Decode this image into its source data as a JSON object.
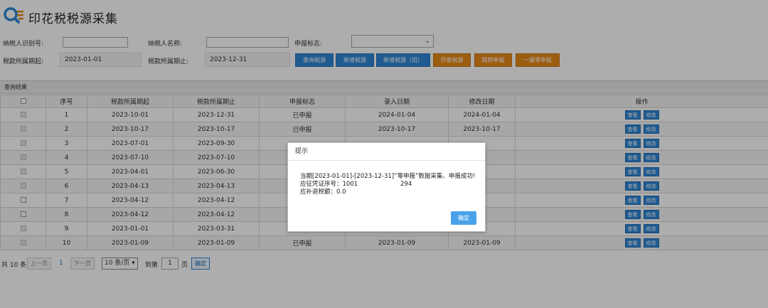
{
  "header": {
    "title": "印花税税源采集"
  },
  "form": {
    "taxpayer_id_label": "纳税人识别号:",
    "taxpayer_name_label": "纳税人名称:",
    "declare_flag_label": "申报标志:",
    "period_start_label": "税款所属期起:",
    "period_start_value": "2023-01-01",
    "period_end_label": "税款所属期止:",
    "period_end_value": "2023-12-31"
  },
  "toolbar": {
    "query": "查询税源",
    "add": "新增税源",
    "add_old": "新增税源（旧）",
    "void": "作废税源",
    "jump": "跳转申报",
    "zero": "一键零申报"
  },
  "results": {
    "title": "查询结果",
    "columns": [
      "序号",
      "税款所属期起",
      "税款所属期止",
      "申报标志",
      "录入日期",
      "修改日期",
      "操作"
    ],
    "view_label": "查看",
    "edit_label": "修改",
    "rows": [
      {
        "no": "1",
        "start": "2023-10-01",
        "end": "2023-12-31",
        "flag": "已申报",
        "entry": "2024-01-04",
        "modify": "2024-01-04"
      },
      {
        "no": "2",
        "start": "2023-10-17",
        "end": "2023-10-17",
        "flag": "已申报",
        "entry": "2023-10-17",
        "modify": "2023-10-17"
      },
      {
        "no": "3",
        "start": "2023-07-01",
        "end": "2023-09-30",
        "flag": "",
        "entry": "",
        "modify": ""
      },
      {
        "no": "4",
        "start": "2023-07-10",
        "end": "2023-07-10",
        "flag": "",
        "entry": "",
        "modify": ""
      },
      {
        "no": "5",
        "start": "2023-04-01",
        "end": "2023-06-30",
        "flag": "",
        "entry": "",
        "modify": ""
      },
      {
        "no": "6",
        "start": "2023-04-13",
        "end": "2023-04-13",
        "flag": "",
        "entry": "",
        "modify": ""
      },
      {
        "no": "7",
        "start": "2023-04-12",
        "end": "2023-04-12",
        "flag": "",
        "entry": "",
        "modify": ""
      },
      {
        "no": "8",
        "start": "2023-04-12",
        "end": "2023-04-12",
        "flag": "",
        "entry": "",
        "modify": ""
      },
      {
        "no": "9",
        "start": "2023-01-01",
        "end": "2023-03-31",
        "flag": "",
        "entry": "",
        "modify": ""
      },
      {
        "no": "10",
        "start": "2023-01-09",
        "end": "2023-01-09",
        "flag": "已申报",
        "entry": "2023-01-09",
        "modify": "2023-01-09"
      }
    ]
  },
  "pager": {
    "total": "共 10 条",
    "prev": "上一页",
    "current": "1",
    "next": "下一页",
    "page_size": "10 条/页",
    "goto_label": "到第",
    "goto_value": "1",
    "page_unit": "页",
    "confirm": "确定"
  },
  "dialog": {
    "title": "提示",
    "line1": "当期[2023-01-01]-[2023-12-31]“零申报”数据采集、申报成功!",
    "line2_label": "应征凭证序号：1001",
    "line2_value": "294",
    "line3": "应补退税额：0.0",
    "ok": "确定"
  },
  "colors": {
    "primary": "#2f86d6",
    "orange": "#e88a1a",
    "dialog_button": "#4aa3ea"
  }
}
